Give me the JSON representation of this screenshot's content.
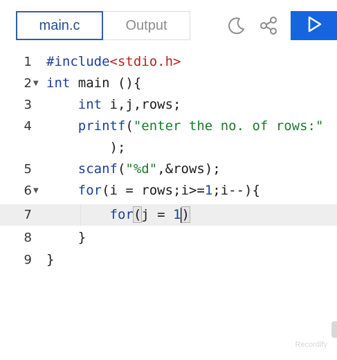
{
  "tabs": {
    "main_label": "main.c",
    "output_label": "Output"
  },
  "icons": {
    "theme": "moon-icon",
    "share": "share-icon",
    "run": "play-icon"
  },
  "colors": {
    "accent": "#1565e0",
    "active_tab_border": "#2a5fa8",
    "keyword": "#1d3d9a",
    "include": "#b22222",
    "string": "#1c7a2a",
    "active_line": "#eeeeee"
  },
  "editor": {
    "active_line": 7,
    "lines": [
      {
        "num": "1",
        "code": "#include<stdio.h>"
      },
      {
        "num": "2",
        "code": "int main (){"
      },
      {
        "num": "3",
        "code": "    int i,j,rows;"
      },
      {
        "num": "4",
        "code": "    printf(\"enter the no. of rows:\""
      },
      {
        "num": "",
        "code": "        );"
      },
      {
        "num": "5",
        "code": "    scanf(\"%d\",&rows);"
      },
      {
        "num": "6",
        "code": "    for(i = rows;i>=1;i--){"
      },
      {
        "num": "7",
        "code": "        for(j = 1)"
      },
      {
        "num": "8",
        "code": "    }"
      },
      {
        "num": "9",
        "code": "}"
      }
    ]
  },
  "watermark": "Recordify"
}
